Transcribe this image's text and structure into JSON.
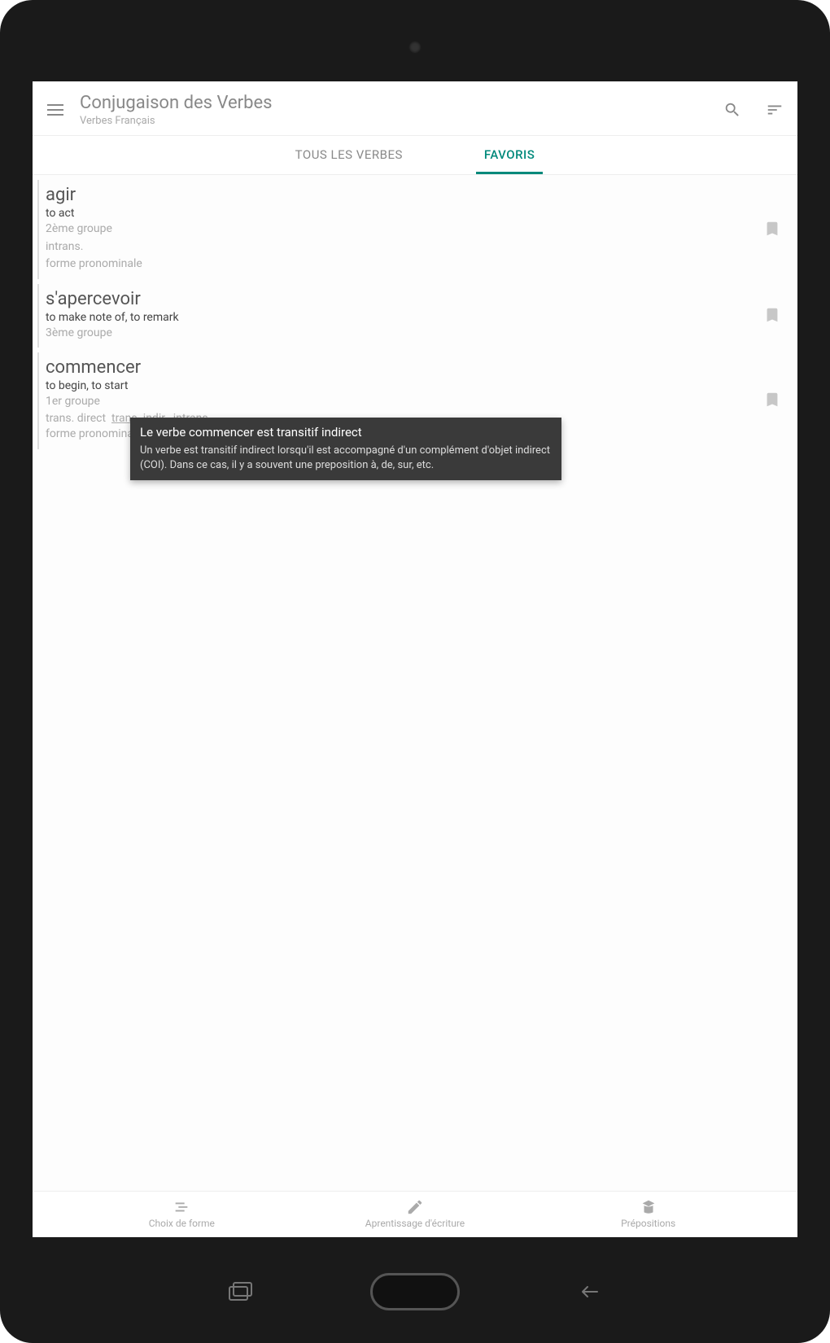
{
  "app_bar": {
    "title": "Conjugaison des Verbes",
    "subtitle": "Verbes Français"
  },
  "tabs": {
    "all": "TOUS LES VERBES",
    "favorites": "FAVORIS"
  },
  "verbs": [
    {
      "name": "agir",
      "translation": "to act",
      "group": "2ème groupe",
      "tags": "intrans.",
      "extra": "forme pronominale"
    },
    {
      "name": "s'apercevoir",
      "translation": "to make note of, to remark",
      "group": "3ème groupe",
      "tags": "",
      "extra": ""
    },
    {
      "name": "commencer",
      "translation": "to begin, to start",
      "group": "1er groupe",
      "tag_direct": "trans. direct",
      "tag_indir": "trans. indir.",
      "tag_intrans": "intrans.",
      "extra": "forme pronominale"
    }
  ],
  "tooltip": {
    "title": "Le verbe commencer est transitif indirect",
    "body": "Un verbe est transitif indirect lorsqu'il est accompagné d'un complément d'objet indirect (COI). Dans ce cas, il y a souvent une preposition à, de, sur, etc."
  },
  "bottom_nav": {
    "form": "Choix de forme",
    "writing": "Aprentissage d'écriture",
    "prepositions": "Prépositions"
  }
}
